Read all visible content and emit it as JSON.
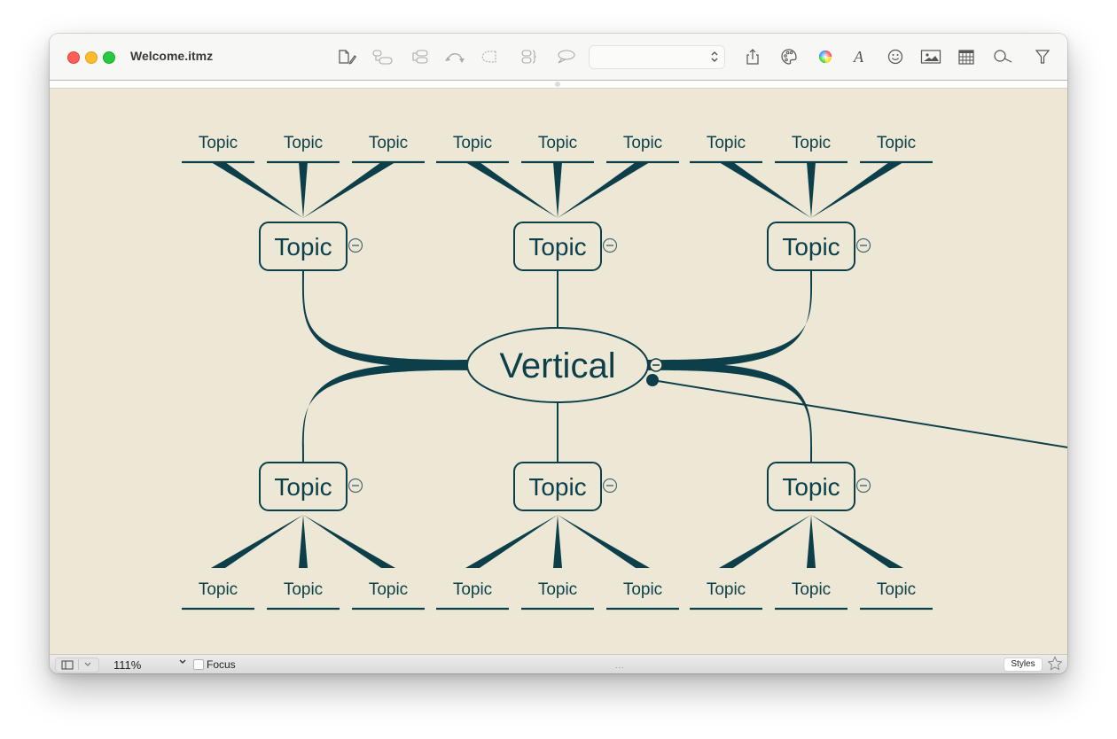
{
  "window": {
    "title": "Welcome.itmz"
  },
  "toolbar": {
    "icons": [
      "new-document-icon",
      "add-child-topic-icon",
      "add-sibling-topic-icon",
      "relationship-icon",
      "boundary-icon",
      "summary-icon",
      "callout-icon",
      "share-icon",
      "palette-icon",
      "color-wheel-icon",
      "font-icon",
      "emoji-icon",
      "image-icon",
      "calendar-icon",
      "search-icon",
      "filter-icon"
    ],
    "style_select_value": ""
  },
  "map": {
    "central_topic": "Vertical",
    "main_topics": [
      {
        "label": "Topic",
        "subtopics": [
          "Topic",
          "Topic",
          "Topic"
        ]
      },
      {
        "label": "Topic",
        "subtopics": [
          "Topic",
          "Topic",
          "Topic"
        ]
      },
      {
        "label": "Topic",
        "subtopics": [
          "Topic",
          "Topic",
          "Topic"
        ]
      },
      {
        "label": "Topic",
        "subtopics": [
          "Topic",
          "Topic",
          "Topic"
        ]
      },
      {
        "label": "Topic",
        "subtopics": [
          "Topic",
          "Topic",
          "Topic"
        ]
      },
      {
        "label": "Topic",
        "subtopics": [
          "Topic",
          "Topic",
          "Topic"
        ]
      }
    ],
    "colors": {
      "background": "#ede8d6",
      "line": "#0d3f4a",
      "text": "#0d3f4a"
    }
  },
  "statusbar": {
    "zoom": "111%",
    "focus_label": "Focus",
    "focus_checked": false,
    "styles_label": "Styles",
    "center_indicator": "..."
  }
}
